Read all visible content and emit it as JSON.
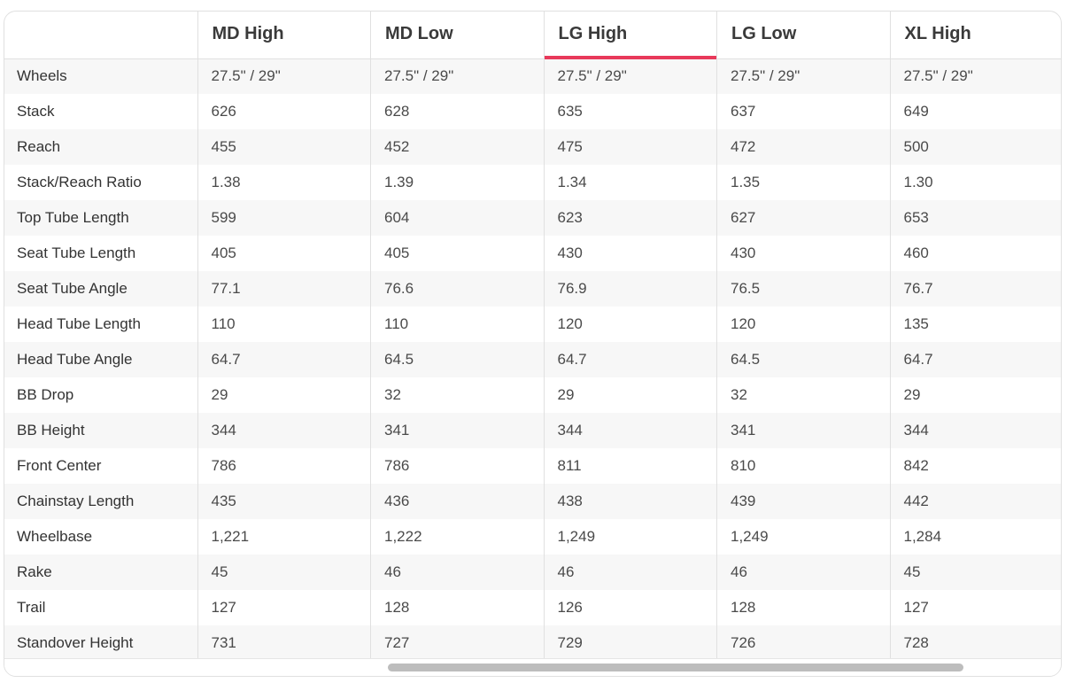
{
  "table": {
    "columns": [
      "",
      "MD High",
      "MD Low",
      "LG High",
      "LG Low",
      "XL High"
    ],
    "active_column": "LG High",
    "accent_color": "#e8395a",
    "rows": [
      {
        "label": "Wheels",
        "values": [
          "27.5\" / 29\"",
          "27.5\" / 29\"",
          "27.5\" / 29\"",
          "27.5\" / 29\"",
          "27.5\" / 29\""
        ]
      },
      {
        "label": "Stack",
        "values": [
          "626",
          "628",
          "635",
          "637",
          "649"
        ]
      },
      {
        "label": "Reach",
        "values": [
          "455",
          "452",
          "475",
          "472",
          "500"
        ]
      },
      {
        "label": "Stack/Reach Ratio",
        "values": [
          "1.38",
          "1.39",
          "1.34",
          "1.35",
          "1.30"
        ]
      },
      {
        "label": "Top Tube Length",
        "values": [
          "599",
          "604",
          "623",
          "627",
          "653"
        ]
      },
      {
        "label": "Seat Tube Length",
        "values": [
          "405",
          "405",
          "430",
          "430",
          "460"
        ]
      },
      {
        "label": "Seat Tube Angle",
        "values": [
          "77.1",
          "76.6",
          "76.9",
          "76.5",
          "76.7"
        ]
      },
      {
        "label": "Head Tube Length",
        "values": [
          "110",
          "110",
          "120",
          "120",
          "135"
        ]
      },
      {
        "label": "Head Tube Angle",
        "values": [
          "64.7",
          "64.5",
          "64.7",
          "64.5",
          "64.7"
        ]
      },
      {
        "label": "BB Drop",
        "values": [
          "29",
          "32",
          "29",
          "32",
          "29"
        ]
      },
      {
        "label": "BB Height",
        "values": [
          "344",
          "341",
          "344",
          "341",
          "344"
        ]
      },
      {
        "label": "Front Center",
        "values": [
          "786",
          "786",
          "811",
          "810",
          "842"
        ]
      },
      {
        "label": "Chainstay Length",
        "values": [
          "435",
          "436",
          "438",
          "439",
          "442"
        ]
      },
      {
        "label": "Wheelbase",
        "values": [
          "1,221",
          "1,222",
          "1,249",
          "1,249",
          "1,284"
        ]
      },
      {
        "label": "Rake",
        "values": [
          "45",
          "46",
          "46",
          "46",
          "45"
        ]
      },
      {
        "label": "Trail",
        "values": [
          "127",
          "128",
          "126",
          "128",
          "127"
        ]
      },
      {
        "label": "Standover Height",
        "values": [
          "731",
          "727",
          "729",
          "726",
          "728"
        ]
      }
    ]
  }
}
